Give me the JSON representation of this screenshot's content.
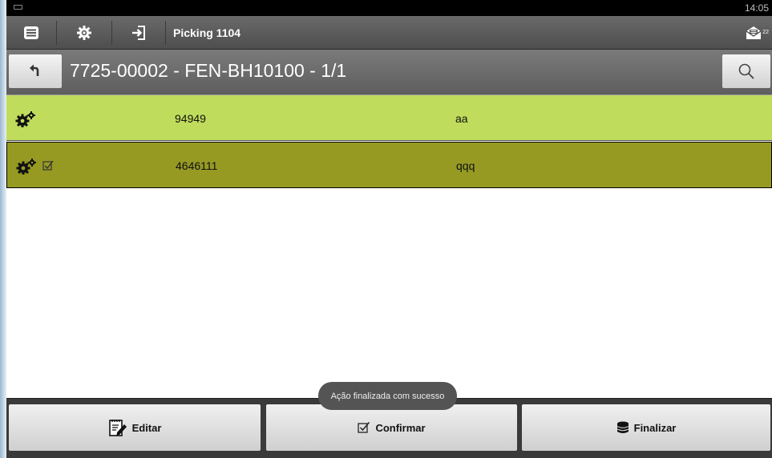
{
  "statusbar": {
    "time": "14:05"
  },
  "actionbar": {
    "title": "Picking 1104",
    "mail_count": "22"
  },
  "subheader": {
    "title": "7725-00002 - FEN-BH10100 - 1/1"
  },
  "list": {
    "rows": [
      {
        "code": "94949",
        "desc": "aa",
        "color": "#bfdc5c",
        "checked": false
      },
      {
        "code": "4646111",
        "desc": "qqq",
        "color": "#969a23",
        "checked": true
      }
    ]
  },
  "bottom": {
    "edit_label": "Editar",
    "confirm_label": "Confirmar",
    "finalize_label": "Finalizar"
  },
  "toast": {
    "text": "Ação finalizada com sucesso"
  },
  "icons": {
    "menu": "list-icon",
    "settings": "gear-icon",
    "login": "sign-in-icon",
    "mail": "mail-icon",
    "back": "back-arrow-icon",
    "search": "search-icon",
    "gears": "gears-icon",
    "checkbox": "checkbox-icon",
    "edit": "edit-icon",
    "database": "database-icon"
  }
}
